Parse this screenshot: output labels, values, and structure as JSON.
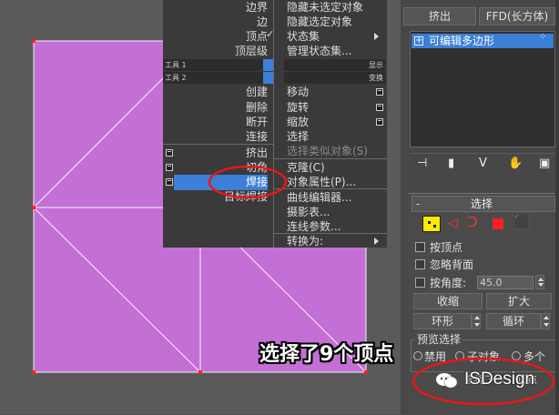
{
  "quad_menu": {
    "left_top_items": [
      {
        "label": "边界",
        "checked": false
      },
      {
        "label": "边",
        "checked": false
      },
      {
        "label": "顶点",
        "checked": true
      },
      {
        "label": "顶层级",
        "checked": false
      }
    ],
    "right_top_items": [
      {
        "label": "隐藏未选定对象"
      },
      {
        "label": "隐藏选定对象"
      },
      {
        "label": "状态集",
        "submenu": true
      },
      {
        "label": "管理状态集..."
      }
    ],
    "header_tools1_left": "工具 1",
    "header_tools1_right": "显示",
    "header_tools2_left": "工具 2",
    "header_tools2_right": "变换",
    "left_bottom_items": [
      {
        "label": "创建",
        "box": false
      },
      {
        "label": "删除",
        "box": false
      },
      {
        "label": "断开",
        "box": false
      },
      {
        "label": "连接",
        "box": false
      },
      {
        "label": "挤出",
        "box": true
      },
      {
        "label": "切角",
        "box": true
      },
      {
        "label": "焊接",
        "box": true,
        "highlighted": true
      },
      {
        "label": "目标焊接",
        "box": false
      }
    ],
    "right_bottom_items": [
      {
        "label": "移动",
        "box": true,
        "disabled": false
      },
      {
        "label": "旋转",
        "box": true,
        "disabled": false
      },
      {
        "label": "缩放",
        "box": true,
        "disabled": false
      },
      {
        "label": "选择",
        "box": false,
        "disabled": false
      },
      {
        "label": "选择类似对象(S)",
        "box": false,
        "disabled": true
      },
      {
        "label": "克隆(C)",
        "box": false,
        "disabled": false
      },
      {
        "label": "对象属性(P)...",
        "box": false,
        "disabled": false
      },
      {
        "label": "曲线编辑器...",
        "box": false,
        "disabled": false
      },
      {
        "label": "摄影表...",
        "box": false,
        "disabled": false
      },
      {
        "label": "连线参数...",
        "box": false,
        "disabled": false
      },
      {
        "label": "转换为:",
        "submenu": true,
        "disabled": false
      }
    ]
  },
  "modifier_panel": {
    "button_extrude": "挤出",
    "button_ffd": "FFD(长方体)",
    "stack_item": "可编辑多边形"
  },
  "selection_rollout": {
    "title": "选择",
    "minus_sign": "-",
    "by_vertex": "按顶点",
    "ignore_backfacing": "忽略背面",
    "by_angle": "按角度:",
    "angle_value": "45.0",
    "shrink": "收缩",
    "grow": "扩大",
    "ring": "环形",
    "loop": "循环",
    "preview_selection": "预览选择",
    "preview_disabled": "禁用",
    "preview_subobject": "子对象",
    "preview_multi": "多个",
    "selected_status": "选择了 9 个顶点"
  },
  "annotation": {
    "text": "选择了9个顶点",
    "watermark": "ISDesign"
  },
  "colors": {
    "mesh_fill": "#c46fd6",
    "highlight": "#3c7fd6",
    "annotation_red": "#e81818",
    "selection_yellow": "#ffea00"
  }
}
